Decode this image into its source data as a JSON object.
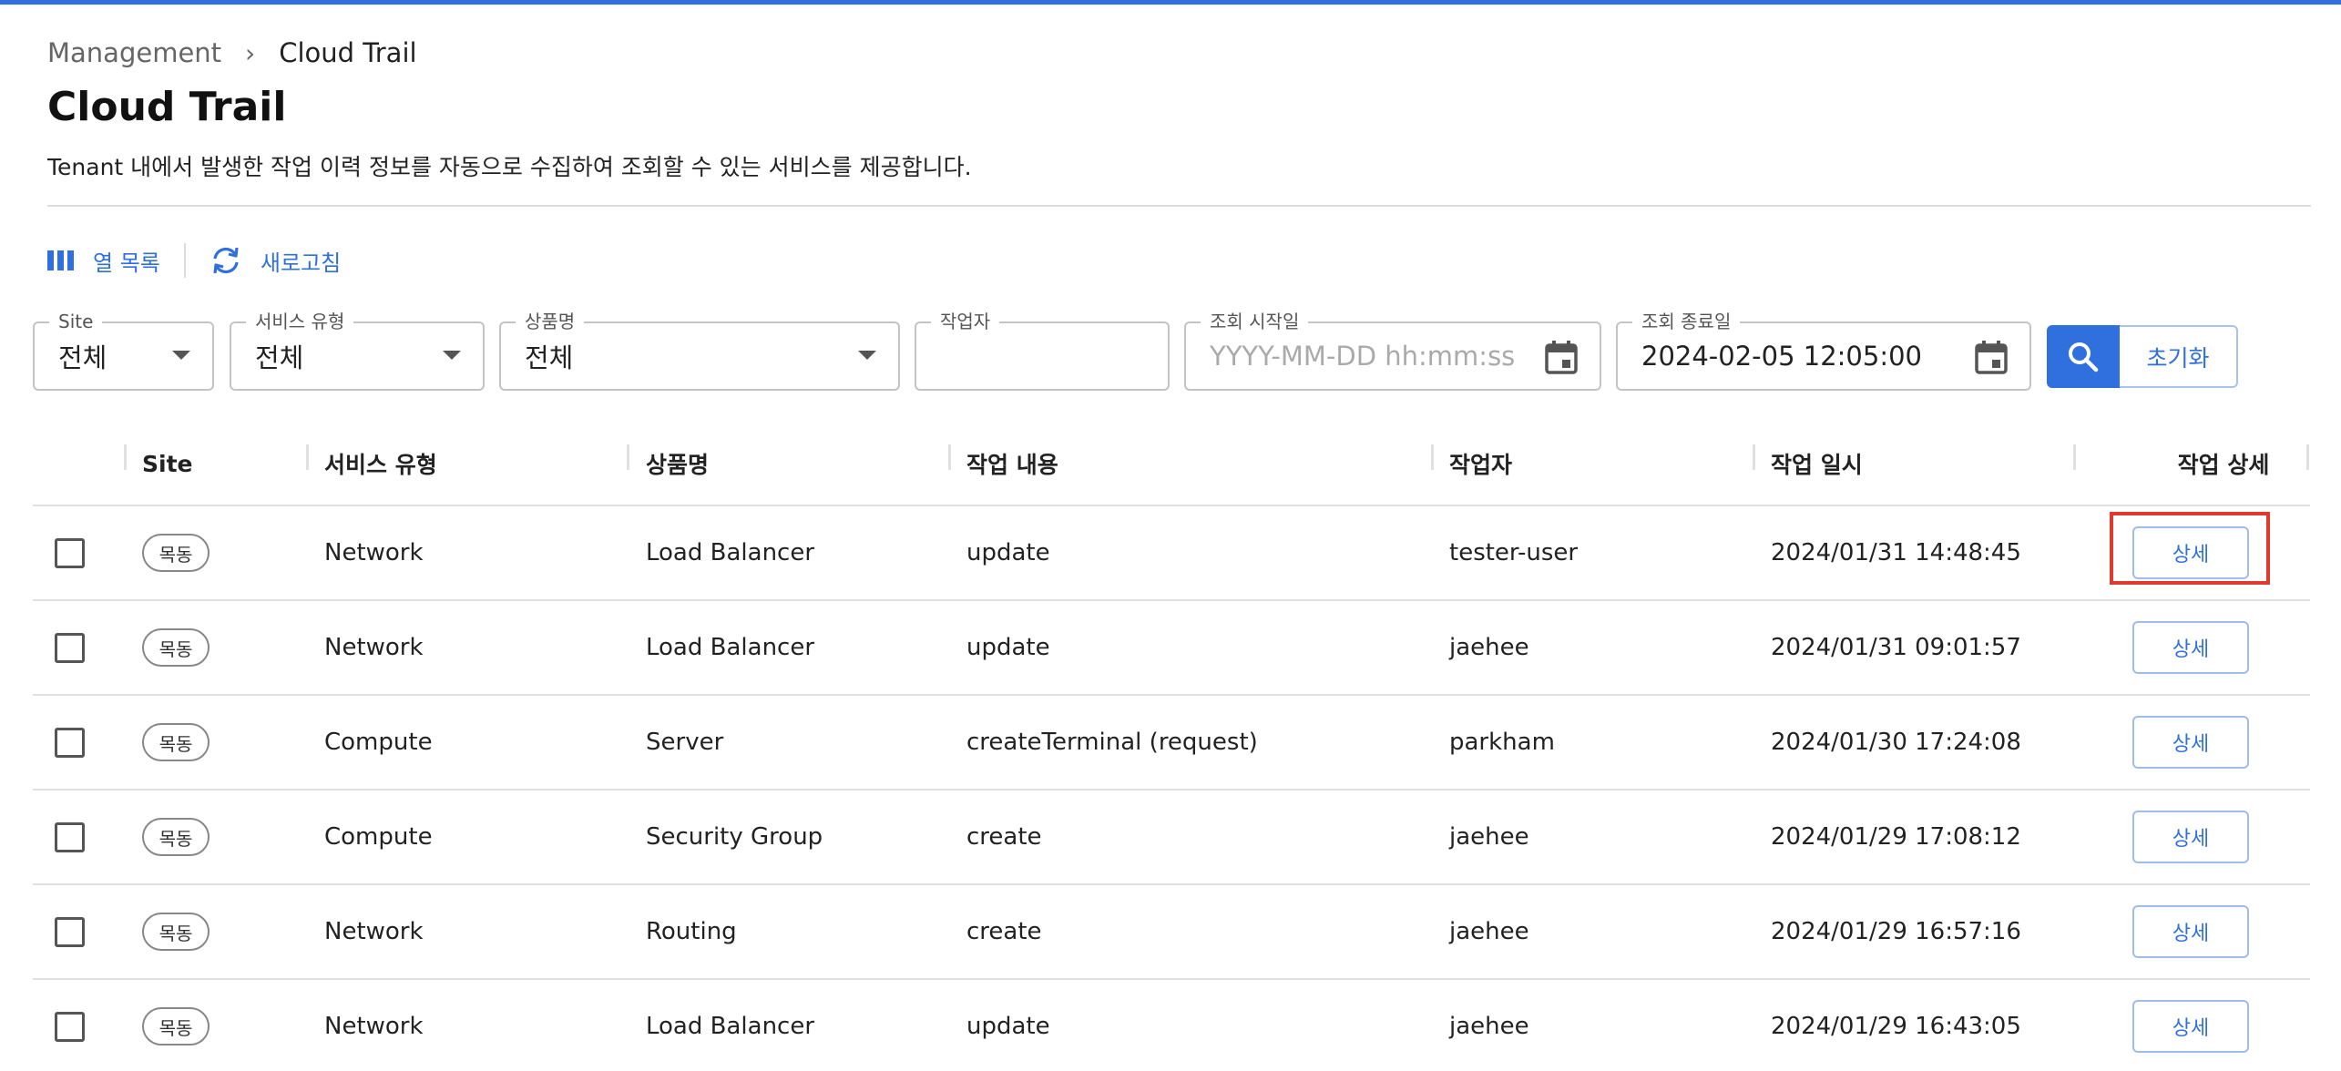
{
  "breadcrumb": {
    "parent": "Management",
    "separator": "›",
    "current": "Cloud Trail"
  },
  "page": {
    "title": "Cloud Trail",
    "description": "Tenant 내에서 발생한 작업 이력 정보를 자동으로 수집하여 조회할 수 있는 서비스를 제공합니다."
  },
  "toolbar": {
    "columns_label": "열 목록",
    "refresh_label": "새로고침"
  },
  "filters": {
    "site": {
      "label": "Site",
      "value": "전체"
    },
    "service_type": {
      "label": "서비스 유형",
      "value": "전체"
    },
    "product": {
      "label": "상품명",
      "value": "전체"
    },
    "worker": {
      "label": "작업자",
      "value": ""
    },
    "start_date": {
      "label": "조회 시작일",
      "placeholder": "YYYY-MM-DD hh:mm:ss",
      "value": ""
    },
    "end_date": {
      "label": "조회 종료일",
      "value": "2024-02-05 12:05:00"
    },
    "reset_label": "초기화"
  },
  "table": {
    "headers": {
      "site": "Site",
      "service_type": "서비스 유형",
      "product": "상품명",
      "action": "작업 내용",
      "worker": "작업자",
      "datetime": "작업 일시",
      "detail": "작업 상세"
    },
    "rows": [
      {
        "site": "목동",
        "service_type": "Network",
        "product": "Load Balancer",
        "action": "update",
        "worker": "tester-user",
        "datetime": "2024/01/31 14:48:45",
        "detail_label": "상세"
      },
      {
        "site": "목동",
        "service_type": "Network",
        "product": "Load Balancer",
        "action": "update",
        "worker": "jaehee",
        "datetime": "2024/01/31 09:01:57",
        "detail_label": "상세"
      },
      {
        "site": "목동",
        "service_type": "Compute",
        "product": "Server",
        "action": "createTerminal (request)",
        "worker": "parkham",
        "datetime": "2024/01/30 17:24:08",
        "detail_label": "상세"
      },
      {
        "site": "목동",
        "service_type": "Compute",
        "product": "Security Group",
        "action": "create",
        "worker": "jaehee",
        "datetime": "2024/01/29 17:08:12",
        "detail_label": "상세"
      },
      {
        "site": "목동",
        "service_type": "Network",
        "product": "Routing",
        "action": "create",
        "worker": "jaehee",
        "datetime": "2024/01/29 16:57:16",
        "detail_label": "상세"
      },
      {
        "site": "목동",
        "service_type": "Network",
        "product": "Load Balancer",
        "action": "update",
        "worker": "jaehee",
        "datetime": "2024/01/29 16:43:05",
        "detail_label": "상세"
      }
    ]
  },
  "colors": {
    "accent": "#2f6fde",
    "highlight": "#e03a2f",
    "divider": "#e0e0e0"
  }
}
